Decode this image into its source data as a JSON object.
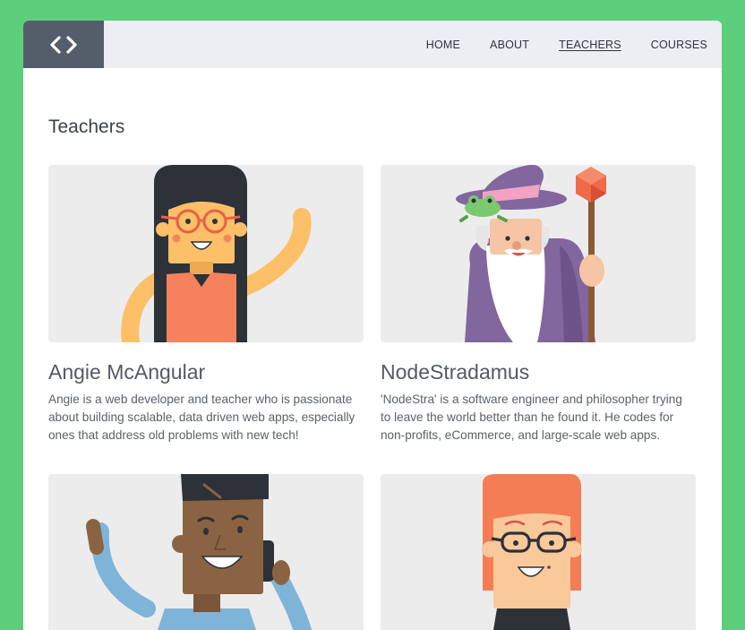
{
  "nav": {
    "logo_icon": "code-brackets-icon",
    "items": [
      {
        "label": "HOME",
        "active": false
      },
      {
        "label": "ABOUT",
        "active": false
      },
      {
        "label": "TEACHERS",
        "active": true
      },
      {
        "label": "COURSES",
        "active": false
      }
    ]
  },
  "page": {
    "title": "Teachers"
  },
  "teachers": [
    {
      "name": "Angie McAngular",
      "bio": "Angie is a web developer and teacher who is passionate about building scalable, data driven web apps, especially ones that address old problems with new tech!",
      "avatar": "woman-glasses-waving-illustration"
    },
    {
      "name": "NodeStradamus",
      "bio": "'NodeStra' is a software engineer and philosopher trying to leave the world better than he found it. He codes for non-profits, eCommerce, and large-scale web apps.",
      "avatar": "wizard-with-frog-illustration"
    },
    {
      "name": "",
      "bio": "",
      "avatar": "man-on-phone-waving-illustration"
    },
    {
      "name": "",
      "bio": "",
      "avatar": "redhead-glasses-illustration"
    }
  ],
  "colors": {
    "background": "#5dcf7c",
    "header": "#eceef1",
    "logo_block": "#545e6b",
    "card_image_bg": "#ececec"
  }
}
